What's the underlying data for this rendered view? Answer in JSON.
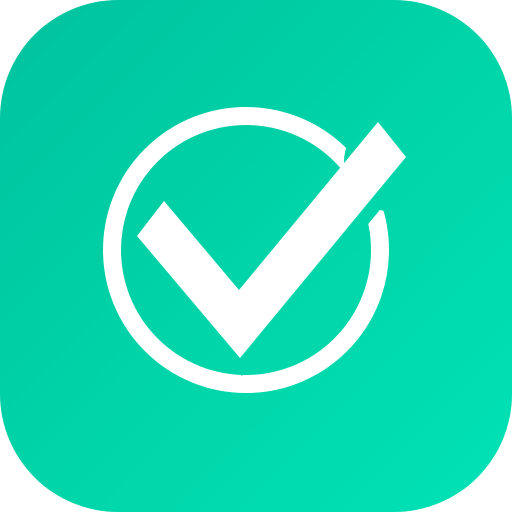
{
  "icon": {
    "name": "check-circle-app-icon",
    "glyph": "check-circle-icon",
    "colors": {
      "gradient_start": "#00c29f",
      "gradient_end": "#00e2b6",
      "glyph": "#ffffff"
    }
  }
}
